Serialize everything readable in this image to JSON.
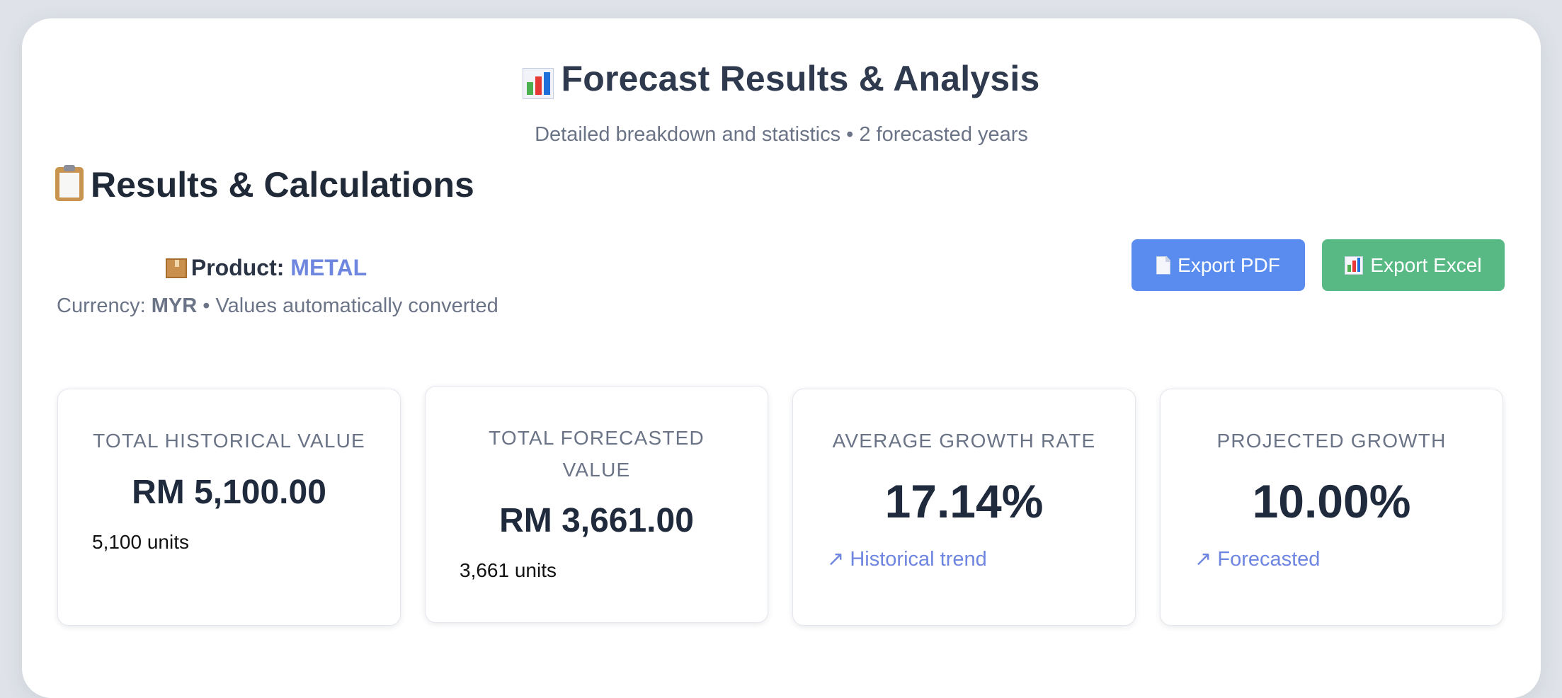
{
  "header": {
    "title": "Forecast Results & Analysis",
    "subtitle": "Detailed breakdown and statistics • 2 forecasted years"
  },
  "section": {
    "title": "Results & Calculations"
  },
  "product": {
    "label": "Product:",
    "value": "METAL"
  },
  "currency": {
    "label": "Currency:",
    "code": "MYR",
    "note": "• Values automatically converted"
  },
  "actions": {
    "export_pdf": "Export PDF",
    "export_excel": "Export Excel"
  },
  "cards": [
    {
      "label": "TOTAL HISTORICAL VALUE",
      "value": "RM 5,100.00",
      "sub": "5,100 units"
    },
    {
      "label": "TOTAL FORECASTED VALUE",
      "value": "RM 3,661.00",
      "sub": "3,661 units"
    },
    {
      "label": "AVERAGE GROWTH RATE",
      "value": "17.14%",
      "sub": "↗ Historical trend"
    },
    {
      "label": "PROJECTED GROWTH",
      "value": "10.00%",
      "sub": "↗ Forecasted"
    }
  ],
  "colors": {
    "accent": "#6f86e0",
    "pdf_button": "#5a8cef",
    "excel_button": "#59b985"
  },
  "icons": [
    "bar-chart-icon",
    "clipboard-icon",
    "package-icon",
    "document-icon",
    "spreadsheet-icon",
    "trend-up-arrow"
  ]
}
